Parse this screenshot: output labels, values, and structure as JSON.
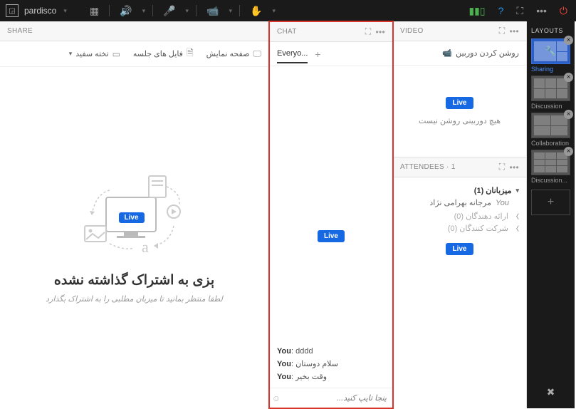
{
  "topbar": {
    "room_name": "pardisco"
  },
  "share": {
    "header": "SHARE",
    "tabs": {
      "screen": "صفحه نمایش",
      "files": "فایل های جلسه",
      "whiteboard": "تخته سفید"
    },
    "live": "Live",
    "heading": "ېزی به اشتراک گذاشته نشده",
    "sub": "لطفا منتظر بمانيد تا ميزبان مطلبی را به اشتراک بگذارد"
  },
  "chat": {
    "header": "CHAT",
    "tab": "Everyo...",
    "live": "Live",
    "messages": [
      {
        "who": "You",
        "text": "dddd"
      },
      {
        "who": "You",
        "text": "سلام دوستان"
      },
      {
        "who": "You",
        "text": "وقت بخير"
      }
    ],
    "placeholder": "ينجا تايپ كنيد..."
  },
  "video": {
    "header": "VIDEO",
    "tab": "روشن کردن دوربین",
    "live": "Live",
    "empty": "هيچ دوربينی روشن نيست"
  },
  "attendees": {
    "header": "ATTENDEES",
    "count": "1",
    "hosts_label": "ميزبانان (1)",
    "user_name": "مرجانه بهرامی نژاد",
    "you_label": "You",
    "presenters_label": "ارائه دهندگان (0)",
    "participants_label": "شركت كنندگان (0)",
    "live": "Live"
  },
  "layouts": {
    "title": "LAYOUTS",
    "items": [
      {
        "label": "Sharing"
      },
      {
        "label": "Discussion"
      },
      {
        "label": "Collaboration"
      },
      {
        "label": "Discussion..."
      }
    ]
  }
}
